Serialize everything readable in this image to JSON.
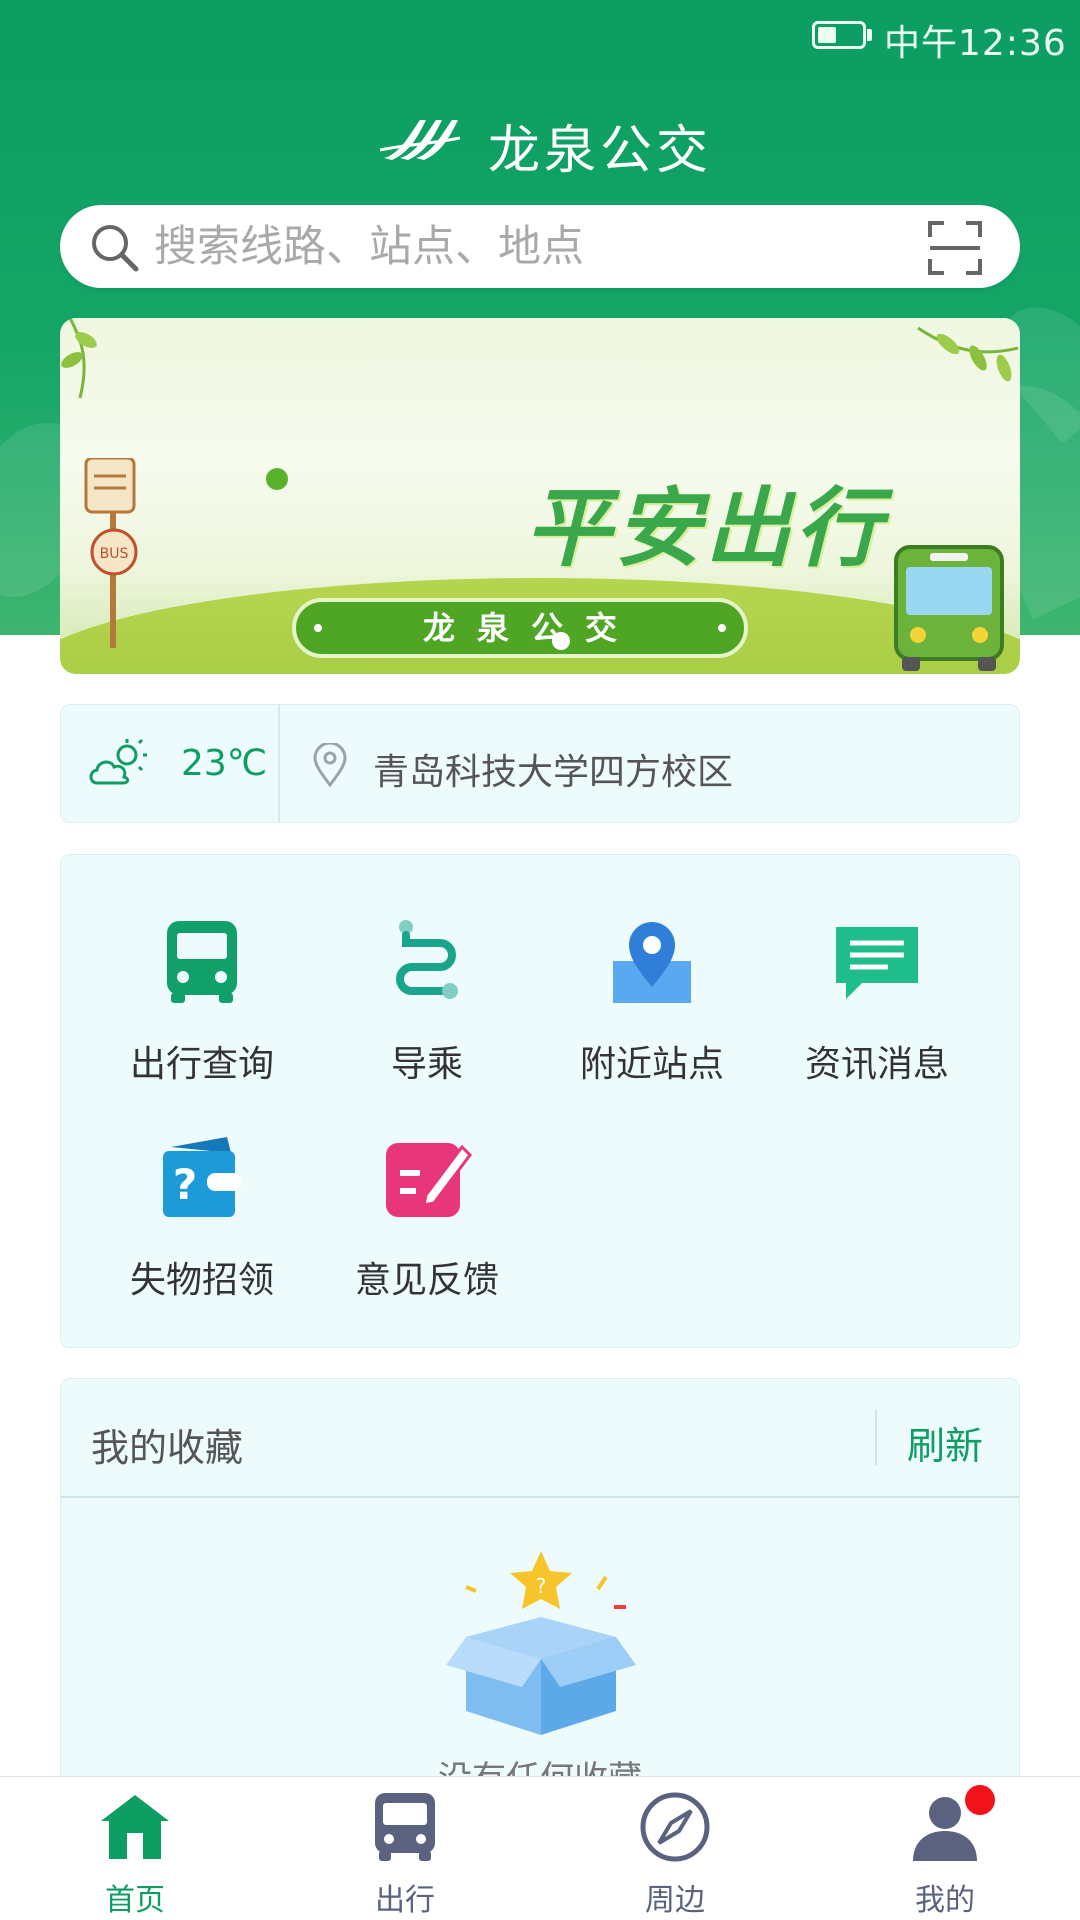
{
  "status_bar": {
    "time": "中午12:36"
  },
  "app": {
    "title": "龙泉公交"
  },
  "search": {
    "placeholder": "搜索线路、站点、地点"
  },
  "banner": {
    "slogan": "平安出行",
    "pill_text": "龙泉公交",
    "sign_text": "BUS"
  },
  "weather": {
    "temperature": "23℃"
  },
  "location": {
    "name": "青岛科技大学四方校区"
  },
  "menu": {
    "items": [
      {
        "label": "出行查询",
        "icon": "bus-icon",
        "color": "#12a06a"
      },
      {
        "label": "导乘",
        "icon": "route-icon",
        "color": "#1aa48c"
      },
      {
        "label": "附近站点",
        "icon": "map-pin-icon",
        "color": "#3a8ee6"
      },
      {
        "label": "资讯消息",
        "icon": "message-icon",
        "color": "#1ebd8a"
      },
      {
        "label": "失物招领",
        "icon": "lost-found-icon",
        "color": "#1d9bd8"
      },
      {
        "label": "意见反馈",
        "icon": "feedback-icon",
        "color": "#e8367a"
      }
    ]
  },
  "favorites": {
    "title": "我的收藏",
    "refresh_label": "刷新",
    "empty_text": "没有任何收藏"
  },
  "bottom_nav": {
    "items": [
      {
        "label": "首页",
        "icon": "home-icon",
        "active": true
      },
      {
        "label": "出行",
        "icon": "bus-icon",
        "active": false
      },
      {
        "label": "周边",
        "icon": "compass-icon",
        "active": false
      },
      {
        "label": "我的",
        "icon": "user-icon",
        "active": false,
        "badge": true
      }
    ]
  },
  "colors": {
    "primary": "#0e9d63",
    "card_bg": "#eefbfc",
    "badge": "#f2131a"
  }
}
